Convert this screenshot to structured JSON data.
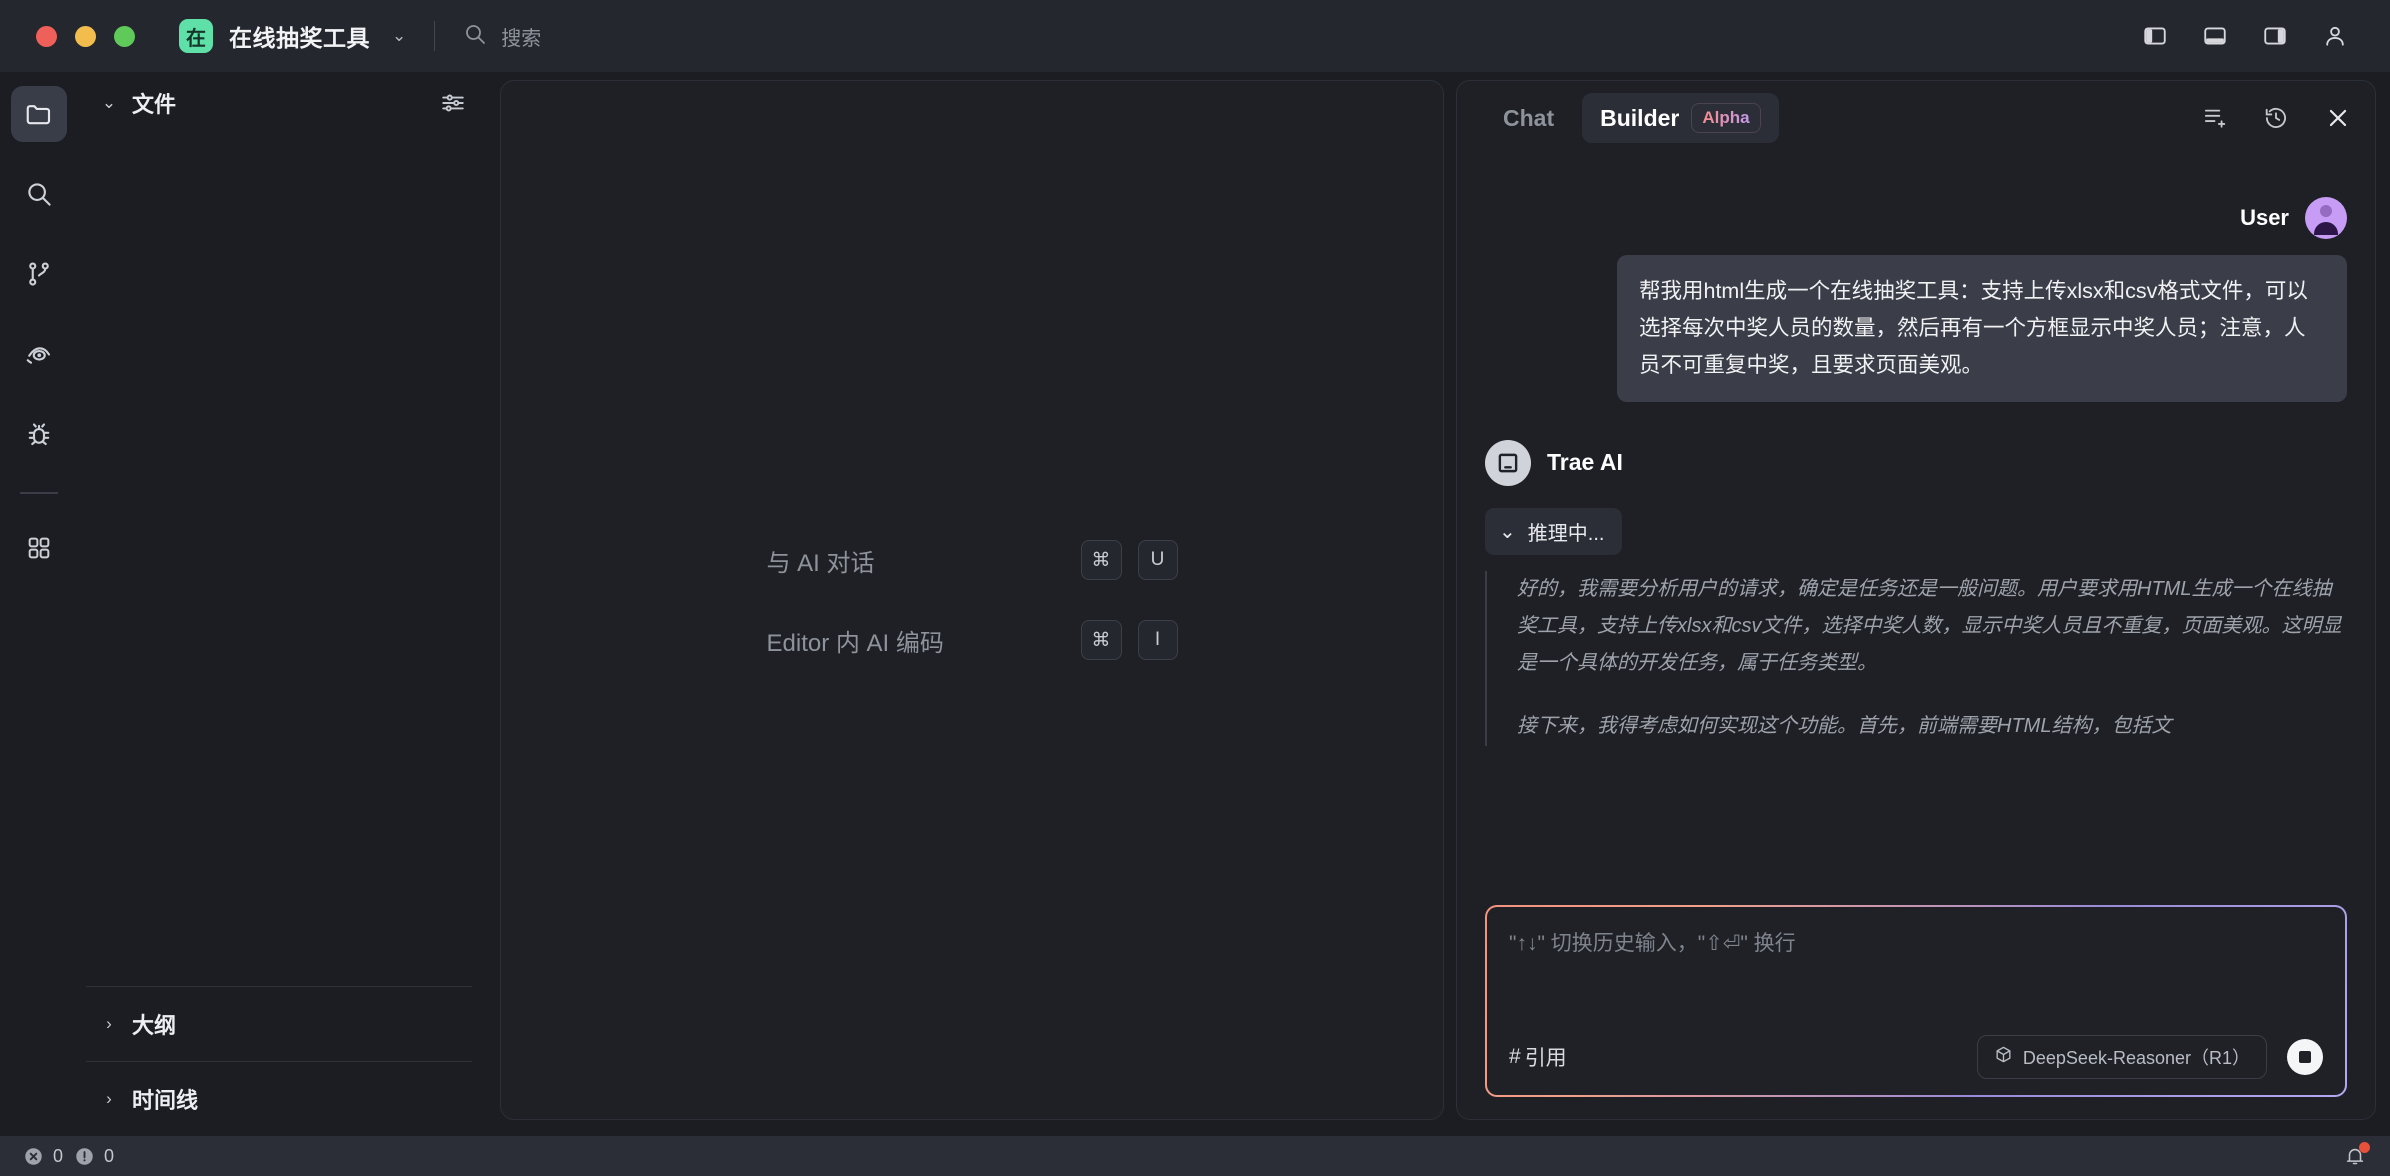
{
  "titlebar": {
    "project_initial": "在",
    "project_name": "在线抽奖工具",
    "chevron": "⌄",
    "search_placeholder": "搜索",
    "icons": {
      "search": "search-icon",
      "left_panel": "left-panel-toggle-icon",
      "bottom_panel": "bottom-panel-toggle-icon",
      "right_panel": "right-panel-toggle-icon",
      "account": "user-account-icon"
    }
  },
  "activitybar": {
    "items": [
      {
        "name": "explorer",
        "icon": "folder-icon",
        "active": true
      },
      {
        "name": "search",
        "icon": "search-icon",
        "active": false
      },
      {
        "name": "source-control",
        "icon": "branch-icon",
        "active": false
      },
      {
        "name": "preview",
        "icon": "eye-icon",
        "active": false
      },
      {
        "name": "debug",
        "icon": "bug-icon",
        "active": false
      },
      {
        "name": "extensions",
        "icon": "grid-icon",
        "active": false
      }
    ]
  },
  "explorer": {
    "files_title": "文件",
    "files_caret": "⌄",
    "filter_icon": "sliders-icon",
    "sections": [
      {
        "caret": "›",
        "title": "大纲"
      },
      {
        "caret": "›",
        "title": "时间线"
      }
    ]
  },
  "editor": {
    "shortcuts": [
      {
        "label": "与 AI 对话",
        "keys": [
          "⌘",
          "U"
        ]
      },
      {
        "label": "Editor 内 AI 编码",
        "keys": [
          "⌘",
          "I"
        ]
      }
    ]
  },
  "ai_panel": {
    "tabs": [
      {
        "label": "Chat",
        "active": false,
        "badge": null
      },
      {
        "label": "Builder",
        "active": true,
        "badge": "Alpha"
      }
    ],
    "header_icons": {
      "new_chat": "new-chat-icon",
      "history": "history-icon",
      "close": "close-icon"
    },
    "user": {
      "name": "User",
      "avatar": "user-avatar",
      "message": "帮我用html生成一个在线抽奖工具：支持上传xlsx和csv格式文件，可以选择每次中奖人员的数量，然后再有一个方框显示中奖人员；注意，人员不可重复中奖，且要求页面美观。"
    },
    "assistant": {
      "name": "Trae AI",
      "avatar": "trae-ai-icon",
      "thinking_label": "推理中...",
      "thinking_caret": "⌄",
      "reasoning": [
        "好的，我需要分析用户的请求，确定是任务还是一般问题。用户要求用HTML生成一个在线抽奖工具，支持上传xlsx和csv文件，选择中奖人数，显示中奖人员且不重复，页面美观。这明显是一个具体的开发任务，属于任务类型。",
        "接下来，我得考虑如何实现这个功能。首先，前端需要HTML结构，包括文"
      ]
    },
    "composer": {
      "placeholder": "\"↑↓\" 切换历史输入，\"⇧⏎\" 换行",
      "quote_label": "引用",
      "quote_prefix": "#",
      "model_name": "DeepSeek-Reasoner（R1）",
      "model_icon": "cube-icon",
      "stop_button": "stop-generation-button",
      "border_gradient": [
        "#f2937f",
        "#b6a8f0"
      ]
    }
  },
  "statusbar": {
    "errors_count": "0",
    "warnings_count": "0",
    "error_icon": "error-circle-icon",
    "warning_icon": "warning-circle-icon",
    "notification_icon": "bell-icon",
    "has_notification": true
  },
  "colors": {
    "background": "#1b1d23",
    "titlebar": "#25272e",
    "panel": "#1e2026",
    "accent_green": "#5fe0a8",
    "accent_purple": "#c79cf5",
    "alert_red": "#e8503a"
  }
}
